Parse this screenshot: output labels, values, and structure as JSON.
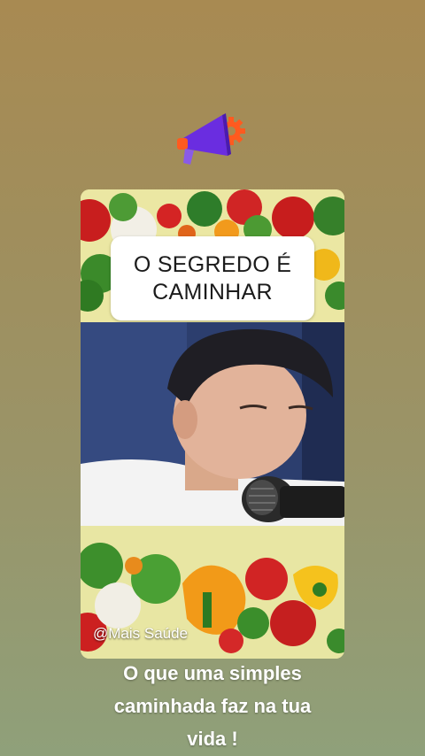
{
  "sticker": {
    "icon": "megaphone-icon"
  },
  "video": {
    "title_line_1": "O SEGREDO É",
    "title_line_2": "CAMINHAR",
    "watermark": "@Mais Saúde"
  },
  "caption": {
    "line_1": "O que uma simples",
    "line_2": "caminhada faz na tua",
    "line_3": "vida !"
  },
  "colors": {
    "background_top": "#a88a52",
    "background_bottom": "#8fa07a",
    "megaphone": "#6a2de0",
    "gear": "#ff5a1f",
    "caption_text": "#ffffff"
  }
}
